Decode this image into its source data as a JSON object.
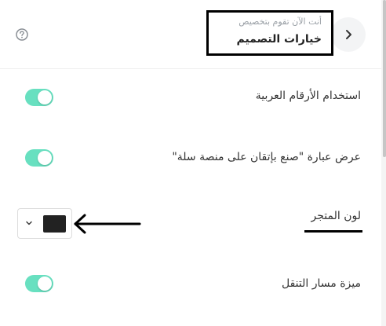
{
  "header": {
    "subtitle": "أنت الآن تقوم بتخصيص",
    "title": "خيارات التصميم",
    "back_icon": "chevron-right-icon",
    "help_icon": "question-circle-icon"
  },
  "settings": [
    {
      "label": "استخدام الأرقام العربية",
      "type": "toggle",
      "enabled": true
    },
    {
      "label": "عرض عبارة \"صنع بإتقان على منصة سلة\"",
      "type": "toggle",
      "enabled": true
    },
    {
      "label": "لون المتجر",
      "type": "color",
      "value": "#222222"
    },
    {
      "label": "ميزة مسار التنقل",
      "type": "toggle",
      "enabled": true
    }
  ],
  "colors": {
    "toggle_on": "#68e0c0",
    "store_color": "#222222"
  }
}
